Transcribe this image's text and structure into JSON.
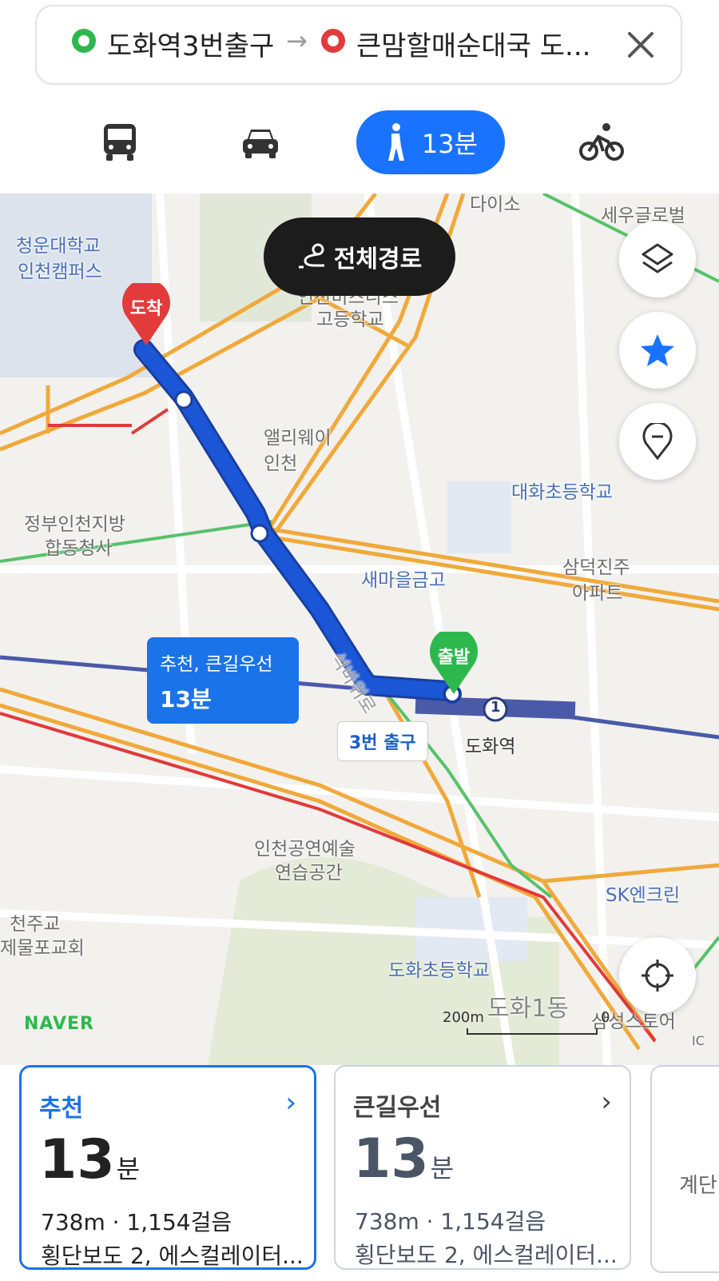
{
  "search": {
    "origin": "도화역3번출구",
    "destination": "큰맘할매순대국 도...",
    "arrow": "→",
    "close_icon": "close-icon"
  },
  "modes": [
    {
      "name": "bus",
      "icon": "bus-icon"
    },
    {
      "name": "car",
      "icon": "car-icon"
    },
    {
      "name": "walk",
      "icon": "walk-icon",
      "label": "13분",
      "active": true
    },
    {
      "name": "bike",
      "icon": "bike-icon"
    }
  ],
  "map": {
    "overview_label": "전체경로",
    "labels": {
      "daiso": "다이소",
      "sewoo": "세우글로벌",
      "chungwoon1": "청운대학교",
      "chungwoon2": "인천캠퍼스",
      "school1": "인천비즈니스",
      "school2": "고등학교",
      "alley1": "앨리웨이",
      "alley2": "인천",
      "daehwa": "대화초등학교",
      "gov1": "정부인천지방",
      "gov2": "합동청사",
      "samdeok1": "삼덕진주",
      "samdeok2": "아파트",
      "saemaul": "새마을금고",
      "road": "석바위로",
      "station": "도화역",
      "station_no": "1",
      "perf1": "인천공연예술",
      "perf2": "연습공간",
      "church1": "천주교",
      "church2": "제물포교회",
      "sk": "SK엔크린",
      "dohwa_school": "도화초등학교",
      "dong": "도화1동",
      "samsung": "삼성스토어",
      "ic": "IC"
    },
    "arrival_pin": "도착",
    "departure_pin": "출발",
    "route_bubble": {
      "line1": "추천, 큰길우선",
      "line2": "13분"
    },
    "exit_label": "3번 출구",
    "brand": "NAVER",
    "scale": "200m",
    "scale_zero": "0"
  },
  "cards": [
    {
      "title": "추천",
      "time": "13",
      "unit": "분",
      "dist": "738m · 1,154걸음",
      "info": "횡단보도 2, 에스컬레이터...",
      "selected": true,
      "accent": "#1a73e8"
    },
    {
      "title": "큰길우선",
      "time": "13",
      "unit": "분",
      "dist": "738m · 1,154걸음",
      "info": "횡단보도 2, 에스컬레이터...",
      "selected": false,
      "accent": "#444"
    },
    {
      "title": "계단"
    }
  ],
  "colors": {
    "primary": "#1a73ff",
    "start": "#2db84d",
    "end": "#e33b3b",
    "route": "#1a56d6"
  }
}
